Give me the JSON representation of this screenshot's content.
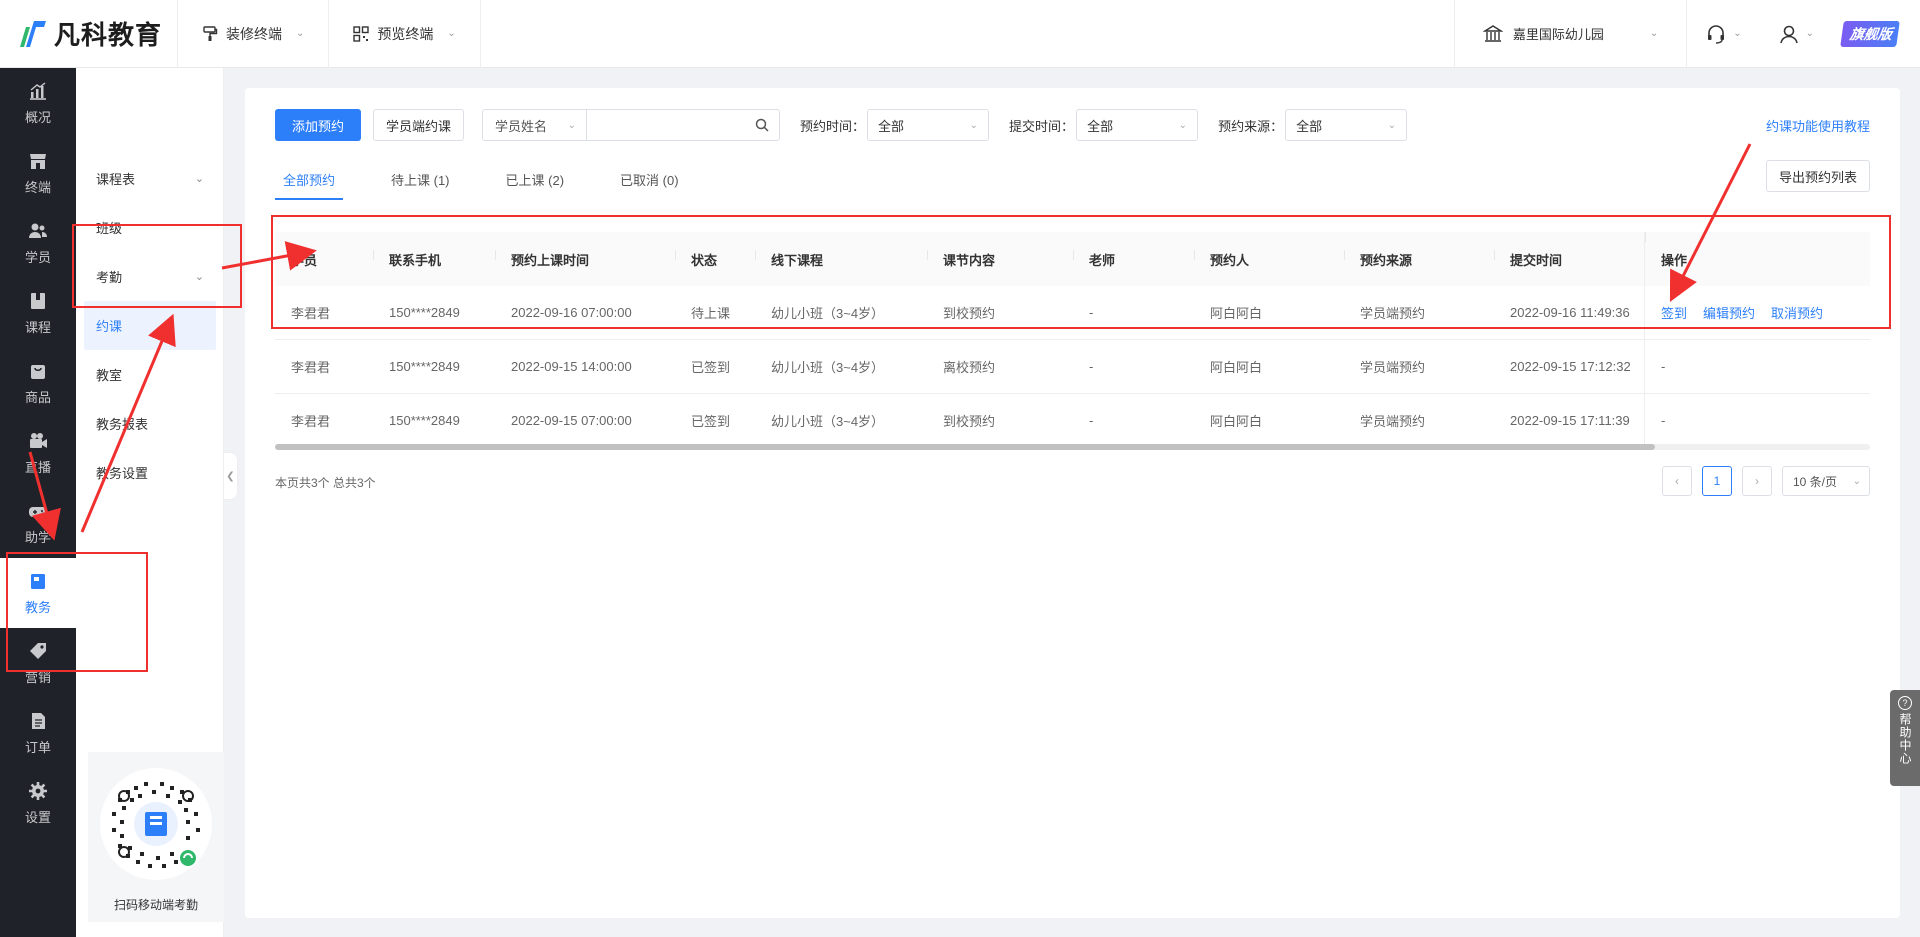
{
  "brand": {
    "name": "凡科教育",
    "accent": "#2d7ff9",
    "logo_colors": [
      "#2fb86b",
      "#2d7ff9"
    ]
  },
  "topbar": {
    "nav": [
      {
        "label": "装修终端",
        "icon": "brush-icon"
      },
      {
        "label": "预览终端",
        "icon": "qrcode-icon"
      }
    ],
    "school": "嘉里国际幼儿园",
    "edition": "旗舰版"
  },
  "sidebar": {
    "items": [
      {
        "label": "概况",
        "icon": "chart-icon"
      },
      {
        "label": "终端",
        "icon": "store-icon"
      },
      {
        "label": "学员",
        "icon": "users-icon"
      },
      {
        "label": "课程",
        "icon": "book-icon"
      },
      {
        "label": "商品",
        "icon": "bag-icon"
      },
      {
        "label": "直播",
        "icon": "video-icon"
      },
      {
        "label": "助学",
        "icon": "gamepad-icon"
      },
      {
        "label": "教务",
        "icon": "calendar-icon"
      },
      {
        "label": "营销",
        "icon": "tag-icon"
      },
      {
        "label": "订单",
        "icon": "document-icon"
      },
      {
        "label": "设置",
        "icon": "gear-icon"
      }
    ],
    "active": "教务"
  },
  "submenu": {
    "items": [
      {
        "label": "课程表",
        "has_arrow": true
      },
      {
        "label": "班级"
      },
      {
        "label": "考勤",
        "has_arrow": true
      },
      {
        "label": "约课",
        "active": true
      },
      {
        "label": "教室"
      },
      {
        "label": "教务报表"
      },
      {
        "label": "教务设置"
      }
    ],
    "qr_label": "扫码移动端考勤"
  },
  "toolbar": {
    "add_label": "添加预约",
    "student_booking_label": "学员端约课",
    "search_field": "学员姓名",
    "search_value": "",
    "filters": [
      {
        "label": "预约时间：",
        "value": "全部"
      },
      {
        "label": "提交时间：",
        "value": "全部"
      },
      {
        "label": "预约来源：",
        "value": "全部"
      }
    ],
    "guide_link": "约课功能使用教程",
    "export_label": "导出预约列表"
  },
  "tabs": [
    {
      "label": "全部预约",
      "active": true
    },
    {
      "label": "待上课 (1)"
    },
    {
      "label": "已上课 (2)"
    },
    {
      "label": "已取消 (0)"
    }
  ],
  "table": {
    "headers": [
      "学员",
      "联系手机",
      "预约上课时间",
      "状态",
      "线下课程",
      "课节内容",
      "老师",
      "预约人",
      "预约来源",
      "提交时间",
      "操作"
    ],
    "rows": [
      {
        "cells": [
          "李君君",
          "150****2849",
          "2022-09-16 07:00:00",
          "待上课",
          "幼儿小班（3~4岁）",
          "到校预约",
          "-",
          "阿白阿白",
          "学员端预约",
          "2022-09-16 11:49:36"
        ],
        "ops": [
          "签到",
          "编辑预约",
          "取消预约"
        ]
      },
      {
        "cells": [
          "李君君",
          "150****2849",
          "2022-09-15 14:00:00",
          "已签到",
          "幼儿小班（3~4岁）",
          "离校预约",
          "-",
          "阿白阿白",
          "学员端预约",
          "2022-09-15 17:12:32"
        ],
        "ops": [],
        "empty_op": "-"
      },
      {
        "cells": [
          "李君君",
          "150****2849",
          "2022-09-15 07:00:00",
          "已签到",
          "幼儿小班（3~4岁）",
          "到校预约",
          "-",
          "阿白阿白",
          "学员端预约",
          "2022-09-15 17:11:39"
        ],
        "ops": [],
        "empty_op": "-"
      }
    ]
  },
  "summary": "本页共3个 总共3个",
  "pagination": {
    "current": "1",
    "page_size": "10 条/页"
  },
  "help": "帮助中心"
}
